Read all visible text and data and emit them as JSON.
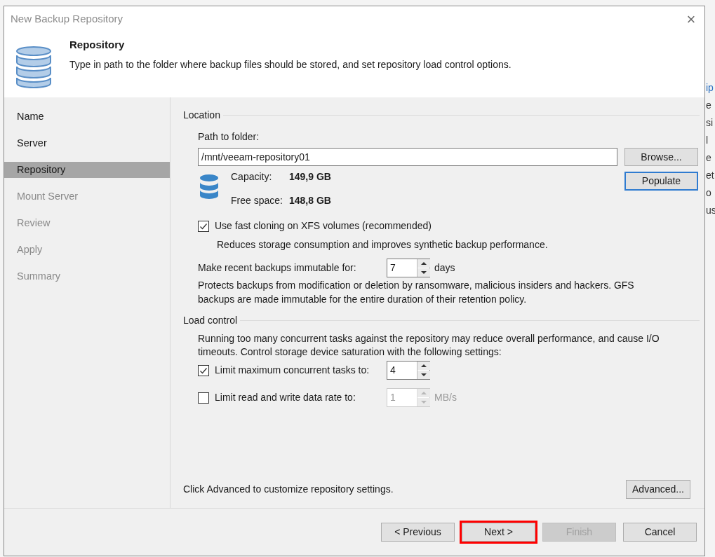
{
  "background_window": {
    "right_edge_texts": [
      {
        "text": "ip",
        "kind": "link"
      },
      {
        "text": "e",
        "kind": "plain"
      },
      {
        "text": "si",
        "kind": "plain"
      },
      {
        "text": "l",
        "kind": "plain"
      },
      {
        "text": "e",
        "kind": "plain"
      },
      {
        "text": "et",
        "kind": "plain"
      },
      {
        "text": "o",
        "kind": "plain"
      },
      {
        "text": "us",
        "kind": "plain"
      }
    ]
  },
  "window": {
    "title": "New Backup Repository",
    "close": "×"
  },
  "header": {
    "title": "Repository",
    "description": "Type in path to the folder where backup files should be stored, and set repository load control options."
  },
  "sidebar": {
    "items": [
      {
        "label": "Name",
        "selected": false,
        "disabled": false
      },
      {
        "label": "Server",
        "selected": false,
        "disabled": false
      },
      {
        "label": "Repository",
        "selected": true,
        "disabled": false
      },
      {
        "label": "Mount Server",
        "selected": false,
        "disabled": true
      },
      {
        "label": "Review",
        "selected": false,
        "disabled": true
      },
      {
        "label": "Apply",
        "selected": false,
        "disabled": true
      },
      {
        "label": "Summary",
        "selected": false,
        "disabled": true
      }
    ]
  },
  "location": {
    "heading": "Location",
    "path_label": "Path to folder:",
    "path_value": "/mnt/veeam-repository01",
    "browse_button": {
      "label": "Browse...",
      "focused": false
    },
    "populate_button": {
      "label": "Populate",
      "focused": true
    },
    "capacity_label": "Capacity:",
    "capacity_value": "149,9 GB",
    "free_label": "Free space:",
    "free_value": "148,8 GB",
    "fast_cloning": {
      "label": "Use fast cloning on XFS volumes (recommended)",
      "checked": true,
      "hint": "Reduces storage consumption and improves synthetic backup performance."
    },
    "immutable": {
      "label": "Make recent backups immutable for:",
      "value": "7",
      "unit": "days",
      "disabled": false
    },
    "immutable_note": "Protects backups from modification or deletion by ransomware, malicious insiders and hackers. GFS backups are made immutable for the entire duration of their retention policy."
  },
  "load_control": {
    "heading": "Load control",
    "note": "Running too many concurrent tasks against the repository may reduce overall performance, and cause I/O timeouts. Control storage device saturation with the following settings:",
    "options": [
      {
        "label": "Limit maximum concurrent tasks to:",
        "checked": true,
        "value": "4",
        "disabled": false
      },
      {
        "label": "Limit read and write data rate to:",
        "checked": false,
        "value": "1",
        "unit": "MB/s",
        "disabled": true
      }
    ]
  },
  "advanced_note": "Click Advanced to customize repository settings.",
  "advanced_button": "Advanced...",
  "footer_buttons": [
    {
      "label": "< Previous",
      "disabled": false,
      "highlighted": false
    },
    {
      "label": "Next >",
      "disabled": false,
      "highlighted": true
    },
    {
      "label": "Finish",
      "disabled": true,
      "highlighted": false
    },
    {
      "label": "Cancel",
      "disabled": false,
      "highlighted": false
    }
  ]
}
